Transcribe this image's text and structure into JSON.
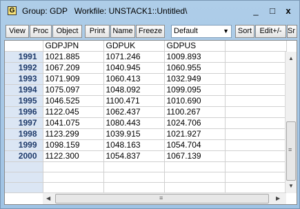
{
  "window": {
    "icon_letter": "G",
    "title": "Group: GDP   Workfile: UNSTACK1::Untitled\\",
    "minimize": "_",
    "maximize": "□",
    "close": "x"
  },
  "toolbar": {
    "buttons": [
      "View",
      "Proc",
      "Object",
      "Print",
      "Name",
      "Freeze",
      "Sort",
      "Edit+/-",
      "Sr"
    ],
    "display_select": "Default"
  },
  "grid": {
    "columns": [
      "GDPJPN",
      "GDPUK",
      "GDPUS"
    ],
    "rows": [
      {
        "label": "1991",
        "values": [
          "1021.885",
          "1071.246",
          "1009.893"
        ]
      },
      {
        "label": "1992",
        "values": [
          "1067.209",
          "1040.945",
          "1060.955"
        ]
      },
      {
        "label": "1993",
        "values": [
          "1071.909",
          "1060.413",
          "1032.949"
        ]
      },
      {
        "label": "1994",
        "values": [
          "1075.097",
          "1048.092",
          "1099.095"
        ]
      },
      {
        "label": "1995",
        "values": [
          "1046.525",
          "1100.471",
          "1010.690"
        ]
      },
      {
        "label": "1996",
        "values": [
          "1122.045",
          "1062.437",
          "1100.267"
        ]
      },
      {
        "label": "1997",
        "values": [
          "1041.075",
          "1080.443",
          "1024.706"
        ]
      },
      {
        "label": "1998",
        "values": [
          "1123.299",
          "1039.915",
          "1021.927"
        ]
      },
      {
        "label": "1999",
        "values": [
          "1098.159",
          "1048.163",
          "1054.704"
        ]
      },
      {
        "label": "2000",
        "values": [
          "1122.300",
          "1054.837",
          "1067.139"
        ]
      }
    ],
    "empty_rows": 3
  },
  "icons": {
    "scroll_up": "▲",
    "scroll_down": "▼",
    "scroll_left": "◀",
    "scroll_right": "▶",
    "grip": "≡"
  }
}
